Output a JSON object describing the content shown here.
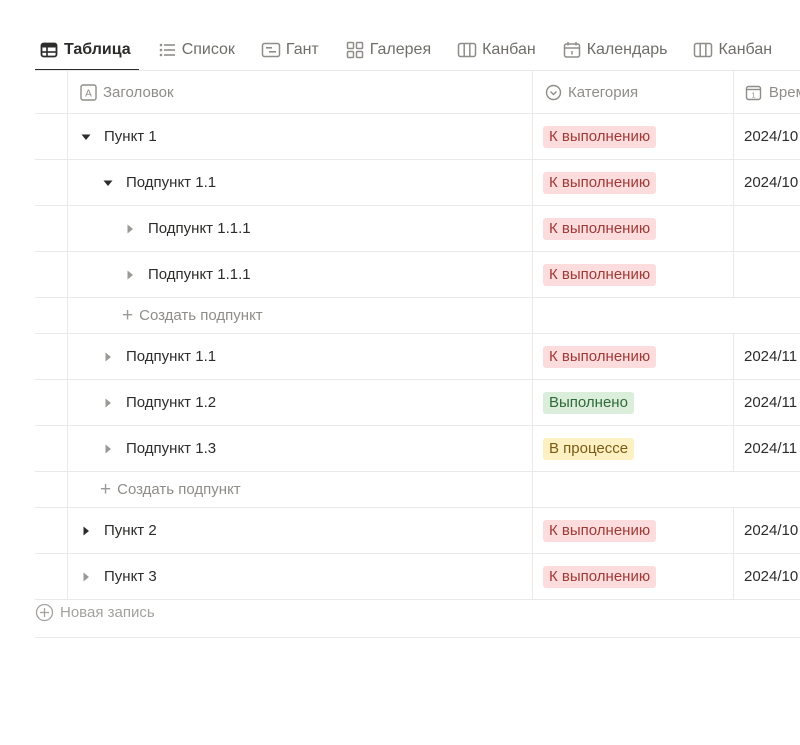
{
  "tabs": [
    {
      "label": "Таблица",
      "icon": "table-icon",
      "active": true
    },
    {
      "label": "Список",
      "icon": "list-icon",
      "active": false
    },
    {
      "label": "Гант",
      "icon": "gantt-icon",
      "active": false
    },
    {
      "label": "Галерея",
      "icon": "gallery-icon",
      "active": false
    },
    {
      "label": "Канбан",
      "icon": "kanban-icon",
      "active": false
    },
    {
      "label": "Календарь",
      "icon": "calendar-icon",
      "active": false
    },
    {
      "label": "Канбан",
      "icon": "kanban-icon",
      "active": false
    }
  ],
  "columns": {
    "title": "Заголовок",
    "category": "Категория",
    "time": "Время"
  },
  "rows": [
    {
      "title": "Пункт 1",
      "status": "К выполнению",
      "date": "2024/10",
      "level": 0,
      "toggle": "open"
    },
    {
      "title": "Подпункт 1.1",
      "status": "К выполнению",
      "date": "2024/10",
      "level": 1,
      "toggle": "open"
    },
    {
      "title": "Подпункт 1.1.1",
      "status": "К выполнению",
      "date": "",
      "level": 2,
      "toggle": "closed"
    },
    {
      "title": "Подпункт 1.1.1",
      "status": "К выполнению",
      "date": "",
      "level": 2,
      "toggle": "closed"
    },
    {
      "title": "Создать подпункт",
      "level": 2,
      "create": true
    },
    {
      "title": "Подпункт 1.1",
      "status": "К выполнению",
      "date": "2024/11",
      "level": 1,
      "toggle": "closed"
    },
    {
      "title": "Подпункт 1.2",
      "status": "Выполнено",
      "date": "2024/11",
      "level": 1,
      "toggle": "closed"
    },
    {
      "title": "Подпункт 1.3",
      "status": "В процессе",
      "date": "2024/11",
      "level": 1,
      "toggle": "closed"
    },
    {
      "title": "Создать подпункт",
      "level": 1,
      "create": true
    },
    {
      "title": "Пункт 2",
      "status": "К выполнению",
      "date": "2024/10",
      "level": 0,
      "toggle": "closed-dark"
    },
    {
      "title": "Пункт 3",
      "status": "К выполнению",
      "date": "2024/10",
      "level": 0,
      "toggle": "closed"
    }
  ],
  "status_colors": {
    "К выполнению": {
      "bg": "#fcdcdc",
      "fg": "#9f3a37"
    },
    "Выполнено": {
      "bg": "#dbeddb",
      "fg": "#2f6a38"
    },
    "В процессе": {
      "bg": "#fdf0c2",
      "fg": "#7a5b14"
    }
  },
  "new_record": "Новая запись"
}
